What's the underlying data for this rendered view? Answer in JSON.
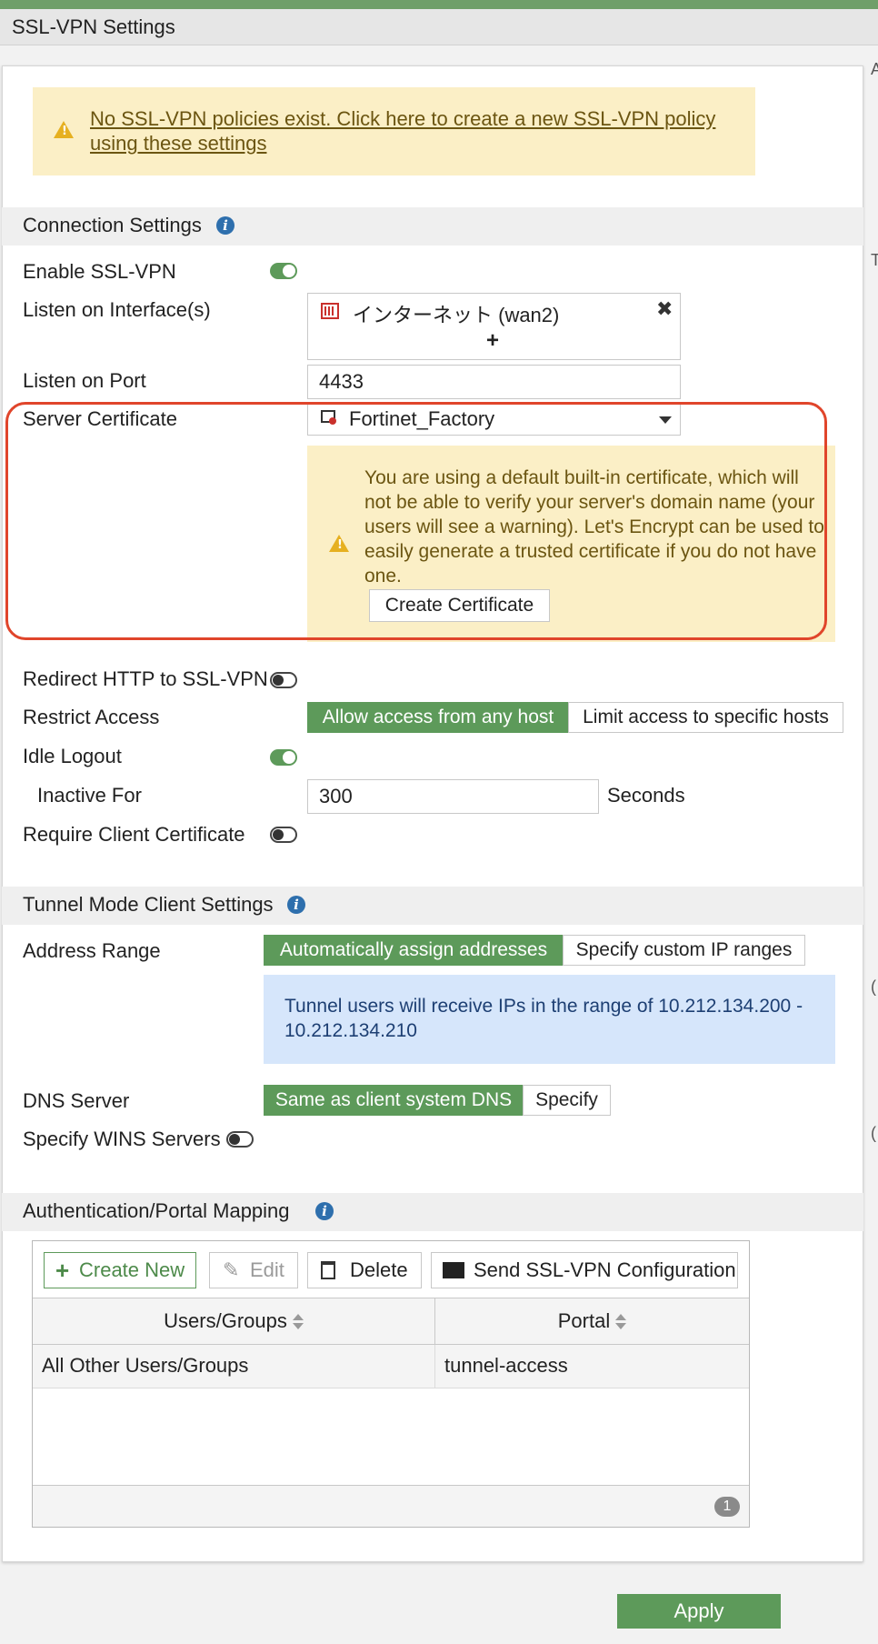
{
  "header": {
    "title": "SSL-VPN Settings"
  },
  "policy_banner": {
    "text": "No SSL-VPN policies exist. Click here to create a new SSL-VPN policy using these settings"
  },
  "connection": {
    "section_title": "Connection Settings",
    "enable_label": "Enable SSL-VPN",
    "listen_interface_label": "Listen on Interface(s)",
    "interface_value": "インターネット (wan2)",
    "add_symbol": "+",
    "listen_port_label": "Listen on Port",
    "listen_port_value": "4433",
    "server_cert_label": "Server Certificate",
    "server_cert_value": "Fortinet_Factory",
    "cert_warning": "You are using a default built-in certificate, which will not be able to verify your server's domain name (your users will see a warning). Let's Encrypt can be used to easily generate a trusted certificate if you do not have one.",
    "create_cert_button": "Create Certificate",
    "redirect_label": "Redirect HTTP to SSL-VPN",
    "restrict_label": "Restrict Access",
    "restrict_options": [
      "Allow access from any host",
      "Limit access to specific hosts"
    ],
    "idle_logout_label": "Idle Logout",
    "inactive_for_label": "Inactive For",
    "inactive_for_value": "300",
    "seconds_label": "Seconds",
    "require_client_cert_label": "Require Client Certificate"
  },
  "tunnel": {
    "section_title": "Tunnel Mode Client Settings",
    "address_range_label": "Address Range",
    "address_options": [
      "Automatically assign addresses",
      "Specify custom IP ranges"
    ],
    "address_info": "Tunnel users will receive IPs in the range of 10.212.134.200 - 10.212.134.210",
    "dns_label": "DNS Server",
    "dns_options": [
      "Same as client system DNS",
      "Specify"
    ],
    "wins_label": "Specify WINS Servers"
  },
  "auth": {
    "section_title": "Authentication/Portal Mapping",
    "toolbar": {
      "create_new": "Create New",
      "edit": "Edit",
      "delete": "Delete",
      "send_config": "Send SSL-VPN Configuration"
    },
    "columns": [
      "Users/Groups",
      "Portal"
    ],
    "rows": [
      {
        "users": "All Other Users/Groups",
        "portal": "tunnel-access"
      }
    ],
    "count": "1"
  },
  "footer": {
    "apply_label": "Apply"
  },
  "colors": {
    "accent_green": "#5d9a5a",
    "warning_bg": "#fbefc6",
    "highlight_red": "#e0452b",
    "info_bg": "#d6e6fb"
  }
}
